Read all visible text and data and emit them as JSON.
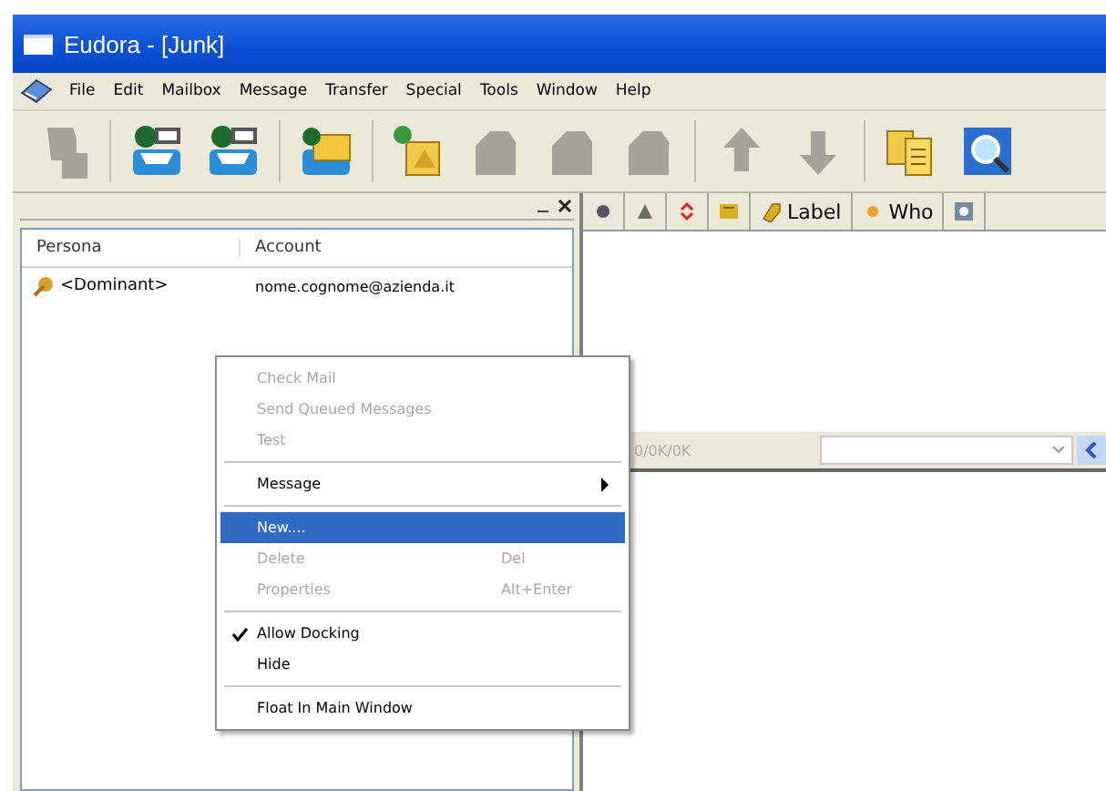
{
  "window": {
    "title": "Eudora - [Junk]"
  },
  "menu_bar": [
    "File",
    "Edit",
    "Mailbox",
    "Message",
    "Transfer",
    "Special",
    "Tools",
    "Window",
    "Help"
  ],
  "toolbar": [
    {
      "kind": "persona",
      "disabled": true
    },
    {
      "kind": "check-mail",
      "disabled": false
    },
    {
      "kind": "check-mail",
      "disabled": false
    },
    {
      "kind": "send",
      "disabled": false
    },
    {
      "kind": "new-message",
      "disabled": false
    },
    {
      "kind": "reply",
      "disabled": true
    },
    {
      "kind": "reply",
      "disabled": true
    },
    {
      "kind": "reply",
      "disabled": true
    },
    {
      "kind": "up",
      "disabled": true
    },
    {
      "kind": "down",
      "disabled": true
    },
    {
      "kind": "address-book",
      "disabled": false
    },
    {
      "kind": "find",
      "disabled": false
    }
  ],
  "personalities": {
    "columns": [
      "Persona",
      "Account"
    ],
    "rows": [
      {
        "persona": "<Dominant>",
        "account": "nome.cognome@azienda.it"
      }
    ]
  },
  "mailbox": {
    "columns": [
      {
        "kind": "status"
      },
      {
        "kind": "junk"
      },
      {
        "kind": "priority"
      },
      {
        "kind": "attachment"
      },
      {
        "kind": "label",
        "label": "Label"
      },
      {
        "kind": "who",
        "label": "Who"
      },
      {
        "kind": "server"
      }
    ],
    "status": "0/0K/0K"
  },
  "context_menu": [
    {
      "kind": "item",
      "label": "Check Mail",
      "disabled": true,
      "selected": false,
      "checked": false
    },
    {
      "kind": "item",
      "label": "Send Queued Messages",
      "disabled": true,
      "selected": false,
      "checked": false
    },
    {
      "kind": "item",
      "label": "Test",
      "disabled": true,
      "selected": false,
      "checked": false
    },
    {
      "kind": "separator"
    },
    {
      "kind": "submenu",
      "label": "Message",
      "disabled": false,
      "selected": false,
      "checked": false
    },
    {
      "kind": "separator"
    },
    {
      "kind": "item",
      "label": "New....",
      "disabled": false,
      "selected": true,
      "checked": false
    },
    {
      "kind": "item",
      "label": "Delete",
      "shortcut": "Del",
      "disabled": true,
      "selected": false,
      "checked": false
    },
    {
      "kind": "item",
      "label": "Properties",
      "shortcut": "Alt+Enter",
      "disabled": true,
      "selected": false,
      "checked": false
    },
    {
      "kind": "separator"
    },
    {
      "kind": "item",
      "label": "Allow Docking",
      "disabled": false,
      "selected": false,
      "checked": true
    },
    {
      "kind": "item",
      "label": "Hide",
      "disabled": false,
      "selected": false,
      "checked": false
    },
    {
      "kind": "separator"
    },
    {
      "kind": "item",
      "label": "Float In Main Window",
      "disabled": false,
      "selected": false,
      "checked": false
    }
  ]
}
